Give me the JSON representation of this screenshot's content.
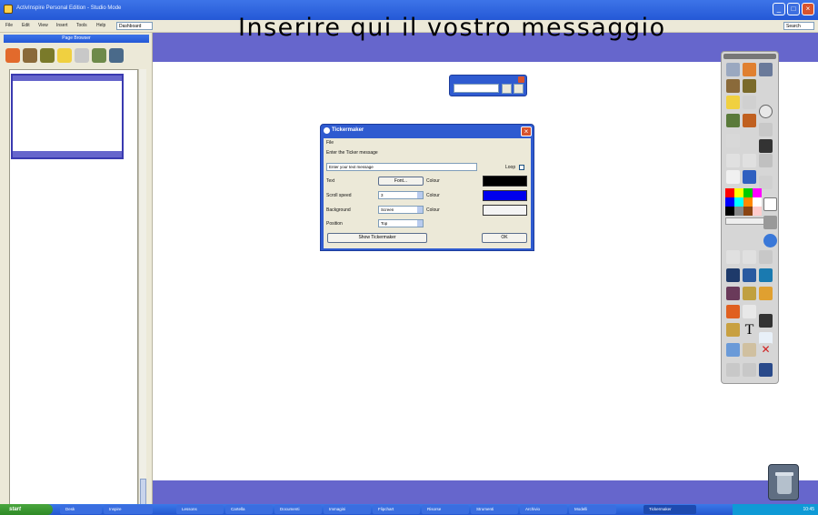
{
  "window": {
    "title": "ActivInspire Personal Edition - Studio Mode"
  },
  "menu": {
    "items": [
      "File",
      "Edit",
      "View",
      "Insert",
      "Tools",
      "Help"
    ],
    "dropdown_value": "Dashboard",
    "right_dropdown_value": "Search"
  },
  "banner": {
    "text": "Inserire qui il vostro messaggio"
  },
  "pagebrowser": {
    "title": "Page Browser"
  },
  "dialog": {
    "title": "Tickermaker",
    "menu": "File",
    "section_label": "Enter the Ticker message",
    "message_value": "Enter your text message",
    "loop_label": "Loop",
    "rows": [
      {
        "label": "Text",
        "control": "Font...",
        "side": "Colour",
        "swatch": "#000000"
      },
      {
        "label": "Scroll speed",
        "control": "3",
        "side": "Colour",
        "swatch": "#0000ee"
      },
      {
        "label": "Background",
        "control": "Screen",
        "side": "Colour",
        "swatch": "#f4f4f4"
      },
      {
        "label": "Position",
        "control": "Top",
        "side": "",
        "swatch": ""
      }
    ],
    "show_button": "Show Tickermaker",
    "ok_button": "OK"
  },
  "taskbar": {
    "start": "start",
    "items": [
      "Desk",
      "Inspire",
      "Lessons",
      "Cartella",
      "Documenti",
      "Immagini",
      "Flipchart",
      "Risorse",
      "Strumenti",
      "Archivio",
      "Modelli",
      "Tickermaker"
    ],
    "clock": "10:45"
  },
  "colors": {
    "accent": "#6666cc",
    "titlebar": "#2458d6",
    "panel": "#ece9d8"
  }
}
